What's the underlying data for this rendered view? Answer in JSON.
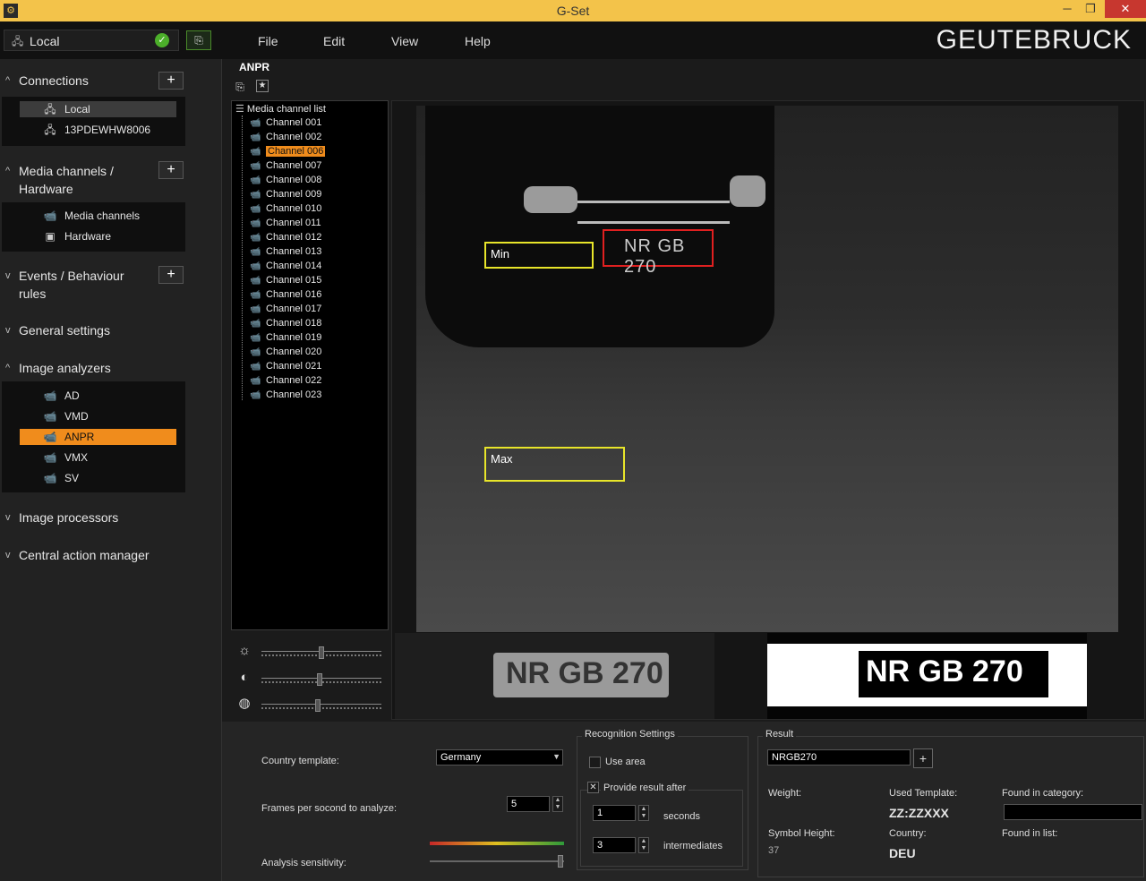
{
  "window": {
    "title": "G-Set",
    "minimize": "─",
    "maximize": "❐",
    "close": "✕"
  },
  "topbar": {
    "connection_label": "Local",
    "menu": [
      "File",
      "Edit",
      "View",
      "Help"
    ],
    "brand": "GEUTEBRUCK"
  },
  "sidebar": {
    "sections": [
      {
        "label": "Connections"
      },
      {
        "label": "Media channels /"
      },
      {
        "label": "Hardware"
      },
      {
        "label": "Events / Behaviour"
      },
      {
        "label": "rules"
      },
      {
        "label": "General settings"
      },
      {
        "label": "Image analyzers"
      },
      {
        "label": "Image processors"
      },
      {
        "label": "Central action manager"
      }
    ],
    "connections": [
      "Local",
      "13PDEWHW8006"
    ],
    "media": [
      "Media channels",
      "Hardware"
    ],
    "analyzers": [
      "AD",
      "VMD",
      "ANPR",
      "VMX",
      "SV"
    ]
  },
  "main": {
    "title": "ANPR",
    "channel_root": "Media channel list",
    "channels": [
      "Channel 001",
      "Channel 002",
      "Channel 006",
      "Channel 007",
      "Channel 008",
      "Channel 009",
      "Channel 010",
      "Channel 011",
      "Channel 012",
      "Channel 013",
      "Channel 014",
      "Channel 015",
      "Channel 016",
      "Channel 017",
      "Channel 018",
      "Channel 019",
      "Channel 020",
      "Channel 021",
      "Channel 022",
      "Channel 023"
    ],
    "selected_channel": "Channel 006",
    "overlay": {
      "min_label": "Min",
      "max_label": "Max",
      "plate_text": "NR GB 270"
    },
    "thumb_plate_gray": "NR GB 270",
    "thumb_plate_bw": "NR GB 270"
  },
  "settings": {
    "country_template_label": "Country template:",
    "country_template_value": "Germany",
    "fps_label": "Frames per socond to analyze:",
    "fps_value": "5",
    "sensitivity_label": "Analysis sensitivity:",
    "recognition": {
      "title": "Recognition Settings",
      "use_area_label": "Use area",
      "provide_result_label": "Provide result after",
      "seconds_value": "1",
      "seconds_label": "seconds",
      "intermediates_value": "3",
      "intermediates_label": "intermediates"
    },
    "result": {
      "title": "Result",
      "value": "NRGB270",
      "weight_label": "Weight:",
      "used_template_label": "Used Template:",
      "used_template_value": "ZZ:ZZXXX",
      "found_category_label": "Found in category:",
      "symbol_height_label": "Symbol Height:",
      "symbol_height_value": "37",
      "country_label": "Country:",
      "country_value": "DEU",
      "found_list_label": "Found in list:"
    }
  },
  "colors": {
    "accent": "#f08c1c",
    "titlebar": "#f3c34a",
    "min_max_box": "#e8e52a",
    "plate_box": "#e02020"
  }
}
